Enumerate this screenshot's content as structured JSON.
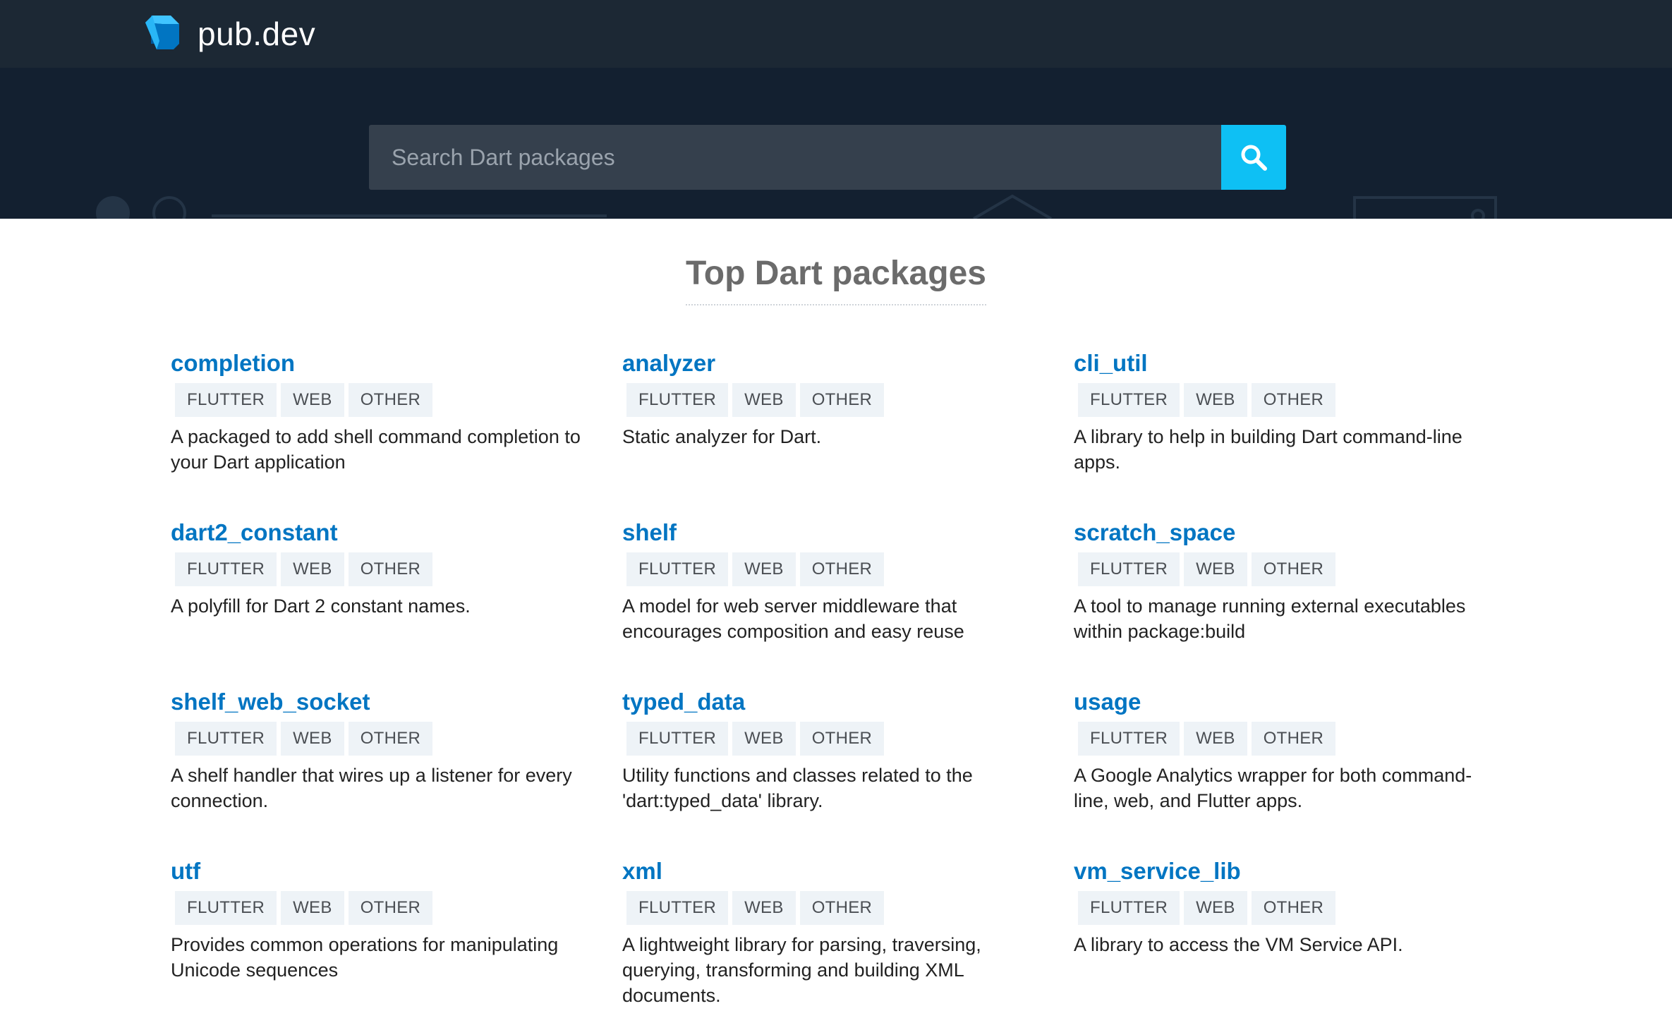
{
  "header": {
    "logo_icon": "dart-logo-icon",
    "logo_text": "pub.dev"
  },
  "search": {
    "placeholder": "Search Dart packages",
    "button_icon": "search-icon"
  },
  "section": {
    "title": "Top Dart packages"
  },
  "colors": {
    "topbar": "#1c2834",
    "hero": "#132030",
    "search_button": "#0ec0f4",
    "link": "#0175c2",
    "tag_bg": "#eef3f7"
  },
  "packages": [
    {
      "name": "completion",
      "tags": [
        "FLUTTER",
        "WEB",
        "OTHER"
      ],
      "description": "A packaged to add shell command completion to your Dart application"
    },
    {
      "name": "analyzer",
      "tags": [
        "FLUTTER",
        "WEB",
        "OTHER"
      ],
      "description": "Static analyzer for Dart."
    },
    {
      "name": "cli_util",
      "tags": [
        "FLUTTER",
        "WEB",
        "OTHER"
      ],
      "description": "A library to help in building Dart command-line apps."
    },
    {
      "name": "dart2_constant",
      "tags": [
        "FLUTTER",
        "WEB",
        "OTHER"
      ],
      "description": "A polyfill for Dart 2 constant names."
    },
    {
      "name": "shelf",
      "tags": [
        "FLUTTER",
        "WEB",
        "OTHER"
      ],
      "description": "A model for web server middleware that encourages composition and easy reuse"
    },
    {
      "name": "scratch_space",
      "tags": [
        "FLUTTER",
        "WEB",
        "OTHER"
      ],
      "description": "A tool to manage running external executables within package:build"
    },
    {
      "name": "shelf_web_socket",
      "tags": [
        "FLUTTER",
        "WEB",
        "OTHER"
      ],
      "description": "A shelf handler that wires up a listener for every connection."
    },
    {
      "name": "typed_data",
      "tags": [
        "FLUTTER",
        "WEB",
        "OTHER"
      ],
      "description": "Utility functions and classes related to the 'dart:typed_data' library."
    },
    {
      "name": "usage",
      "tags": [
        "FLUTTER",
        "WEB",
        "OTHER"
      ],
      "description": "A Google Analytics wrapper for both command-line, web, and Flutter apps."
    },
    {
      "name": "utf",
      "tags": [
        "FLUTTER",
        "WEB",
        "OTHER"
      ],
      "description": "Provides common operations for manipulating Unicode sequences"
    },
    {
      "name": "xml",
      "tags": [
        "FLUTTER",
        "WEB",
        "OTHER"
      ],
      "description": "A lightweight library for parsing, traversing, querying, transforming and building XML documents."
    },
    {
      "name": "vm_service_lib",
      "tags": [
        "FLUTTER",
        "WEB",
        "OTHER"
      ],
      "description": "A library to access the VM Service API."
    }
  ]
}
